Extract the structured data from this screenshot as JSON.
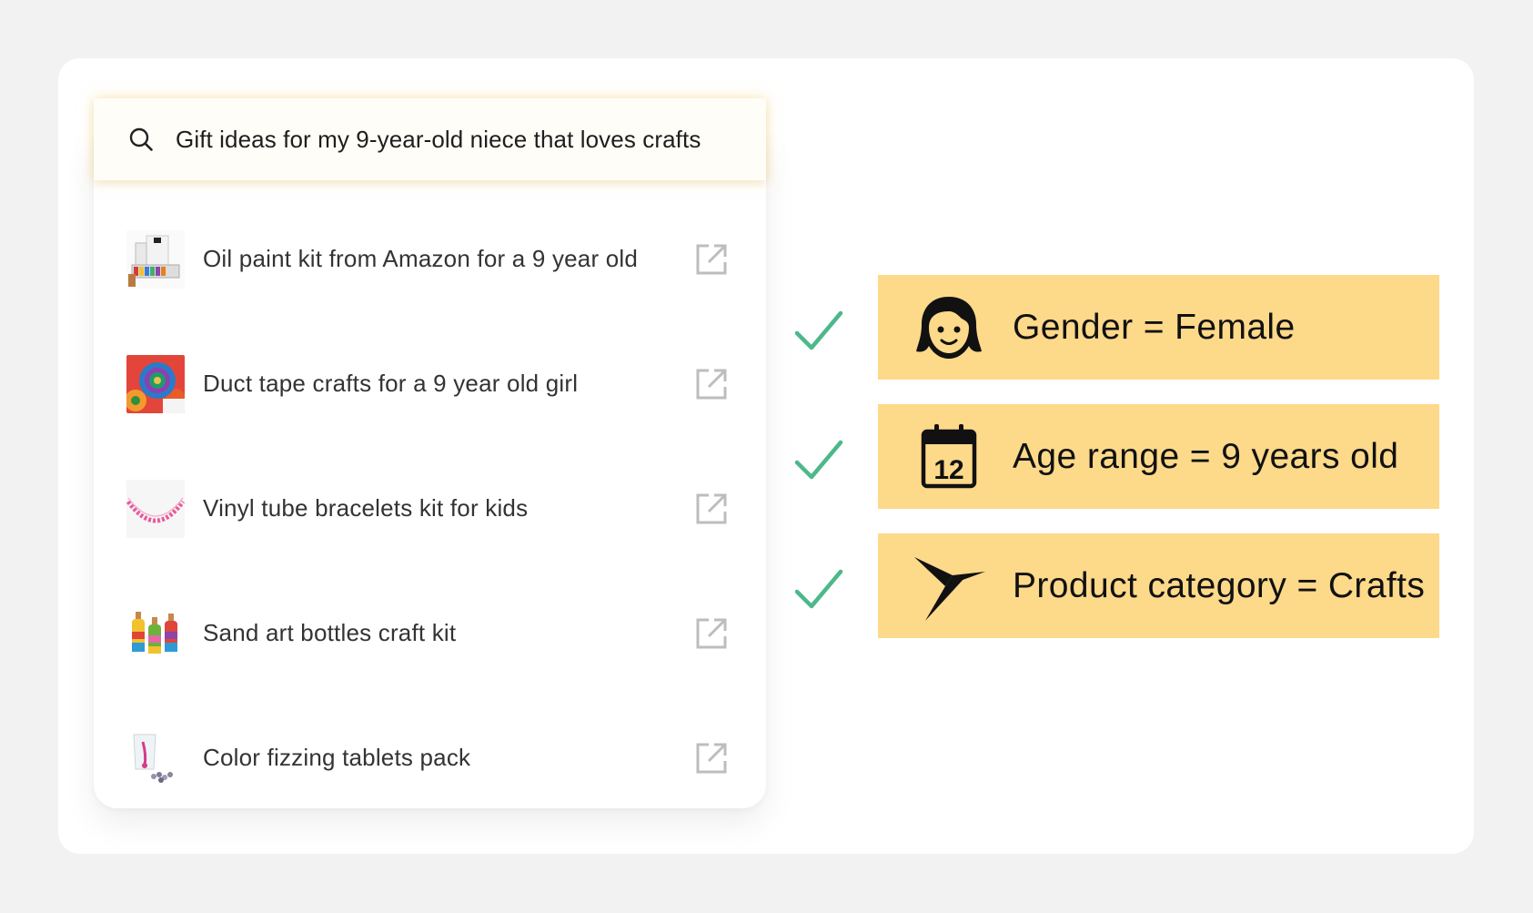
{
  "search": {
    "icon": "search-icon",
    "query": "Gift ideas for my 9-year-old niece that loves crafts"
  },
  "results": [
    {
      "label": "Oil paint kit from Amazon for a 9 year old",
      "thumb": "oil-paint-kit-thumbnail",
      "icon": "external-link-icon"
    },
    {
      "label": "Duct tape crafts for a 9 year old girl",
      "thumb": "duct-tape-flower-thumbnail",
      "icon": "external-link-icon"
    },
    {
      "label": "Vinyl tube bracelets kit for kids",
      "thumb": "bracelet-thumbnail",
      "icon": "external-link-icon"
    },
    {
      "label": "Sand art bottles craft kit",
      "thumb": "sand-art-bottles-thumbnail",
      "icon": "external-link-icon"
    },
    {
      "label": "Color fizzing tablets pack",
      "thumb": "fizzing-tablets-thumbnail",
      "icon": "external-link-icon"
    }
  ],
  "attributes": [
    {
      "text": "Gender = Female",
      "icon": "girl-face-icon"
    },
    {
      "text": "Age range = 9 years old",
      "icon": "calendar-icon",
      "calendar_day": "12"
    },
    {
      "text": "Product category = Crafts",
      "icon": "origami-bird-icon"
    }
  ],
  "colors": {
    "background": "#f2f2f2",
    "card": "#ffffff",
    "attribute_fill": "#fdd98a",
    "check": "#4cb88b",
    "search_glow": "#fad26e"
  }
}
